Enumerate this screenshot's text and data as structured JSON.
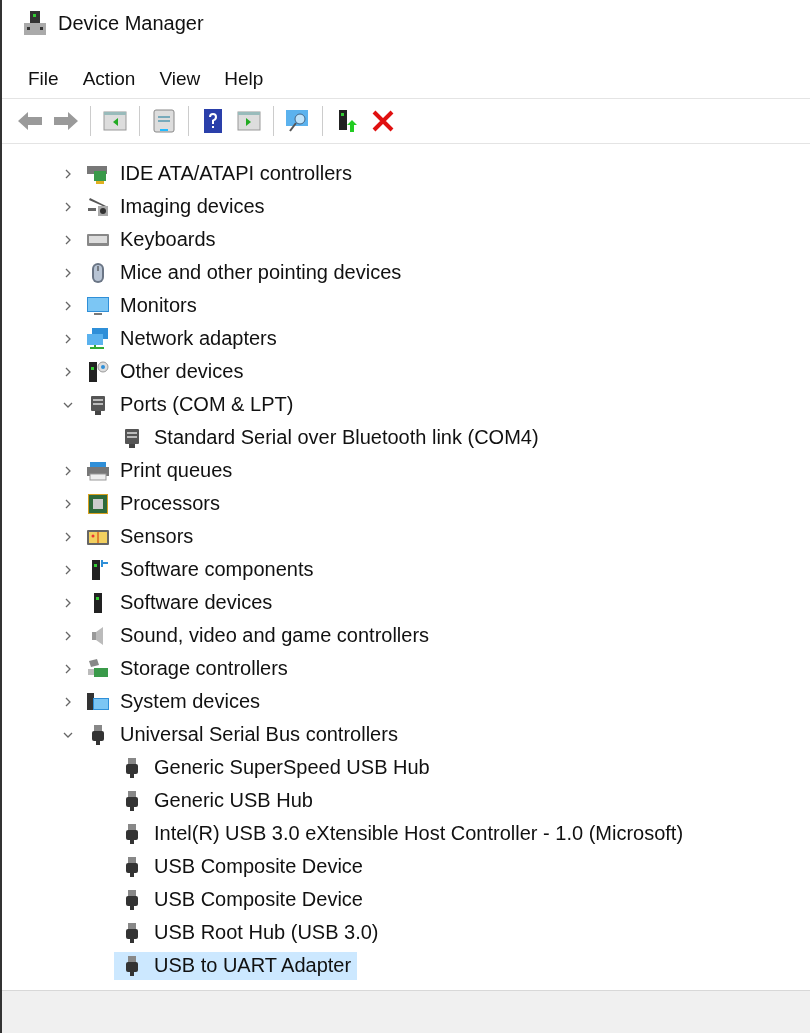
{
  "window": {
    "title": "Device Manager"
  },
  "menu": [
    "File",
    "Action",
    "View",
    "Help"
  ],
  "toolbar": [
    {
      "kind": "back"
    },
    {
      "kind": "forward"
    },
    {
      "kind": "separator"
    },
    {
      "kind": "tree-pane"
    },
    {
      "kind": "separator"
    },
    {
      "kind": "properties"
    },
    {
      "kind": "separator"
    },
    {
      "kind": "help"
    },
    {
      "kind": "action-pane"
    },
    {
      "kind": "separator"
    },
    {
      "kind": "scan"
    },
    {
      "kind": "separator"
    },
    {
      "kind": "update"
    },
    {
      "kind": "uninstall"
    }
  ],
  "tree": [
    {
      "label": "IDE ATA/ATAPI controllers",
      "kind": "ide",
      "expanded": false,
      "selected": false
    },
    {
      "label": "Imaging devices",
      "kind": "imaging",
      "expanded": false,
      "selected": false
    },
    {
      "label": "Keyboards",
      "kind": "keyboard",
      "expanded": false,
      "selected": false
    },
    {
      "label": "Mice and other pointing devices",
      "kind": "mouse",
      "expanded": false,
      "selected": false
    },
    {
      "label": "Monitors",
      "kind": "monitor",
      "expanded": false,
      "selected": false
    },
    {
      "label": "Network adapters",
      "kind": "network",
      "expanded": false,
      "selected": false
    },
    {
      "label": "Other devices",
      "kind": "other",
      "expanded": false,
      "selected": false
    },
    {
      "label": "Ports (COM & LPT)",
      "kind": "port",
      "expanded": true,
      "selected": false,
      "children": [
        {
          "label": "Standard Serial over Bluetooth link (COM4)",
          "kind": "port",
          "selected": false
        }
      ]
    },
    {
      "label": "Print queues",
      "kind": "printer",
      "expanded": false,
      "selected": false
    },
    {
      "label": "Processors",
      "kind": "processor",
      "expanded": false,
      "selected": false
    },
    {
      "label": "Sensors",
      "kind": "sensor",
      "expanded": false,
      "selected": false
    },
    {
      "label": "Software components",
      "kind": "software-component",
      "expanded": false,
      "selected": false
    },
    {
      "label": "Software devices",
      "kind": "software-device",
      "expanded": false,
      "selected": false
    },
    {
      "label": "Sound, video and game controllers",
      "kind": "sound",
      "expanded": false,
      "selected": false
    },
    {
      "label": "Storage controllers",
      "kind": "storage",
      "expanded": false,
      "selected": false
    },
    {
      "label": "System devices",
      "kind": "system",
      "expanded": false,
      "selected": false
    },
    {
      "label": "Universal Serial Bus controllers",
      "kind": "usb",
      "expanded": true,
      "selected": false,
      "children": [
        {
          "label": "Generic SuperSpeed USB Hub",
          "kind": "usb",
          "selected": false
        },
        {
          "label": "Generic USB Hub",
          "kind": "usb",
          "selected": false
        },
        {
          "label": "Intel(R) USB 3.0 eXtensible Host Controller - 1.0 (Microsoft)",
          "kind": "usb",
          "selected": false
        },
        {
          "label": "USB Composite Device",
          "kind": "usb",
          "selected": false
        },
        {
          "label": "USB Composite Device",
          "kind": "usb",
          "selected": false
        },
        {
          "label": "USB Root Hub (USB 3.0)",
          "kind": "usb",
          "selected": false
        },
        {
          "label": "USB to UART Adapter",
          "kind": "usb",
          "selected": true
        }
      ]
    }
  ]
}
